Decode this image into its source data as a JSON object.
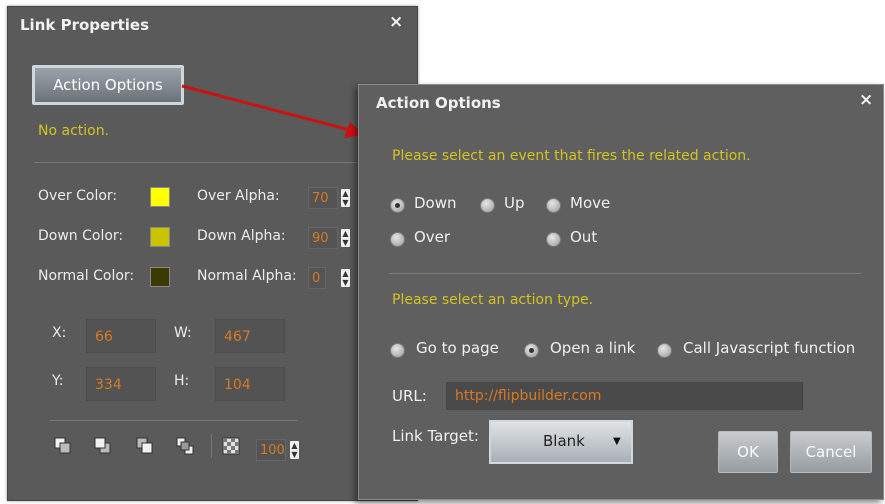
{
  "link_properties": {
    "title": "Link Properties",
    "close_glyph": "×",
    "action_button_label": "Action Options",
    "status_text": "No action.",
    "over_color_label": "Over Color:",
    "over_color": "#ffff00",
    "down_color_label": "Down Color:",
    "down_color": "#c8c400",
    "normal_color_label": "Normal Color:",
    "normal_color": "#3d3a00",
    "over_alpha_label": "Over Alpha:",
    "over_alpha": "70",
    "down_alpha_label": "Down Alpha:",
    "down_alpha": "90",
    "normal_alpha_label": "Normal Alpha:",
    "normal_alpha": "0",
    "x_label": "X:",
    "x_value": "66",
    "w_label": "W:",
    "w_value": "467",
    "y_label": "Y:",
    "y_value": "334",
    "h_label": "H:",
    "h_value": "104",
    "zoom_value": "100",
    "tools": [
      "bring-to-front-icon",
      "bring-forward-icon",
      "send-backward-icon",
      "send-to-back-icon",
      "transparency-icon"
    ]
  },
  "action_options": {
    "title": "Action Options",
    "close_glyph": "×",
    "event_prompt": "Please select an event that fires the related action.",
    "events": [
      {
        "label": "Down",
        "selected": true
      },
      {
        "label": "Up",
        "selected": false
      },
      {
        "label": "Move",
        "selected": false
      },
      {
        "label": "Over",
        "selected": false
      },
      {
        "label": "Out",
        "selected": false
      }
    ],
    "action_prompt": "Please select an action type.",
    "action_types": [
      {
        "label": "Go to page",
        "selected": false
      },
      {
        "label": "Open a link",
        "selected": true
      },
      {
        "label": "Call Javascript function",
        "selected": false
      }
    ],
    "url_label": "URL:",
    "url_value": "http://flipbuilder.com",
    "link_target_label": "Link Target:",
    "link_target_value": "Blank",
    "ok_label": "OK",
    "cancel_label": "Cancel"
  },
  "colors": {
    "accent_text": "#d3c51f",
    "value_text": "#d87a25",
    "arrow": "#cc1111"
  }
}
